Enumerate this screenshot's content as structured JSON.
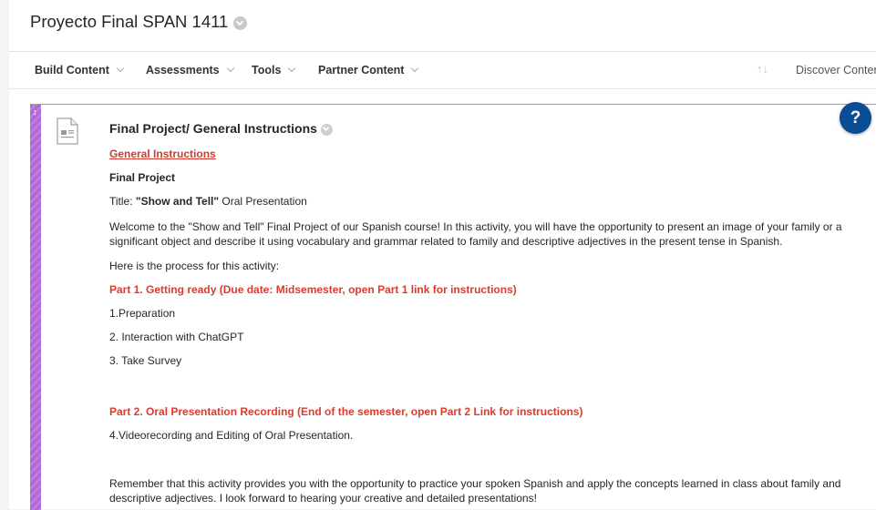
{
  "page": {
    "title": "Proyecto Final SPAN 1411"
  },
  "toolbar": {
    "build_content": "Build Content",
    "assessments": "Assessments",
    "tools": "Tools",
    "partner_content": "Partner Content",
    "sort_glyph": "↑↓",
    "discover": "Discover Conten"
  },
  "help": {
    "glyph": "?"
  },
  "item": {
    "title": "Final Project/ General Instructions",
    "link": "General Instructions",
    "heading": "Final Project",
    "title_line": {
      "prefix": "Title: ",
      "bold": "\"Show and Tell\"",
      "suffix": " Oral Presentation"
    },
    "welcome": "Welcome to the \"Show and Tell\" Final Project of our Spanish course! In this activity, you will have the opportunity to present an image of your family or a significant object and describe it using vocabulary and grammar related to family and descriptive adjectives in the present tense in Spanish.",
    "process_intro": "Here is the process for this activity:",
    "part1": "Part 1. Getting ready (Due date: Midsemester, open Part 1 link for instructions)",
    "step1": "1.Preparation",
    "step2": "2. Interaction with ChatGPT",
    "step3": "3. Take Survey",
    "part2": "Part 2. Oral Presentation Recording (End of the semester, open Part 2 Link for instructions)",
    "step4": "4.Videorecording and Editing of Oral Presentation.",
    "closing": "Remember that this activity provides you with the opportunity to practice your spoken Spanish and apply the concepts learned in class about family and descriptive adjectives. I look forward to hearing your creative and detailed presentations!"
  },
  "colors": {
    "accent_red": "#dd3b2f",
    "item_bar_purple": "#b46ad6",
    "help_blue": "#0b4d95"
  }
}
